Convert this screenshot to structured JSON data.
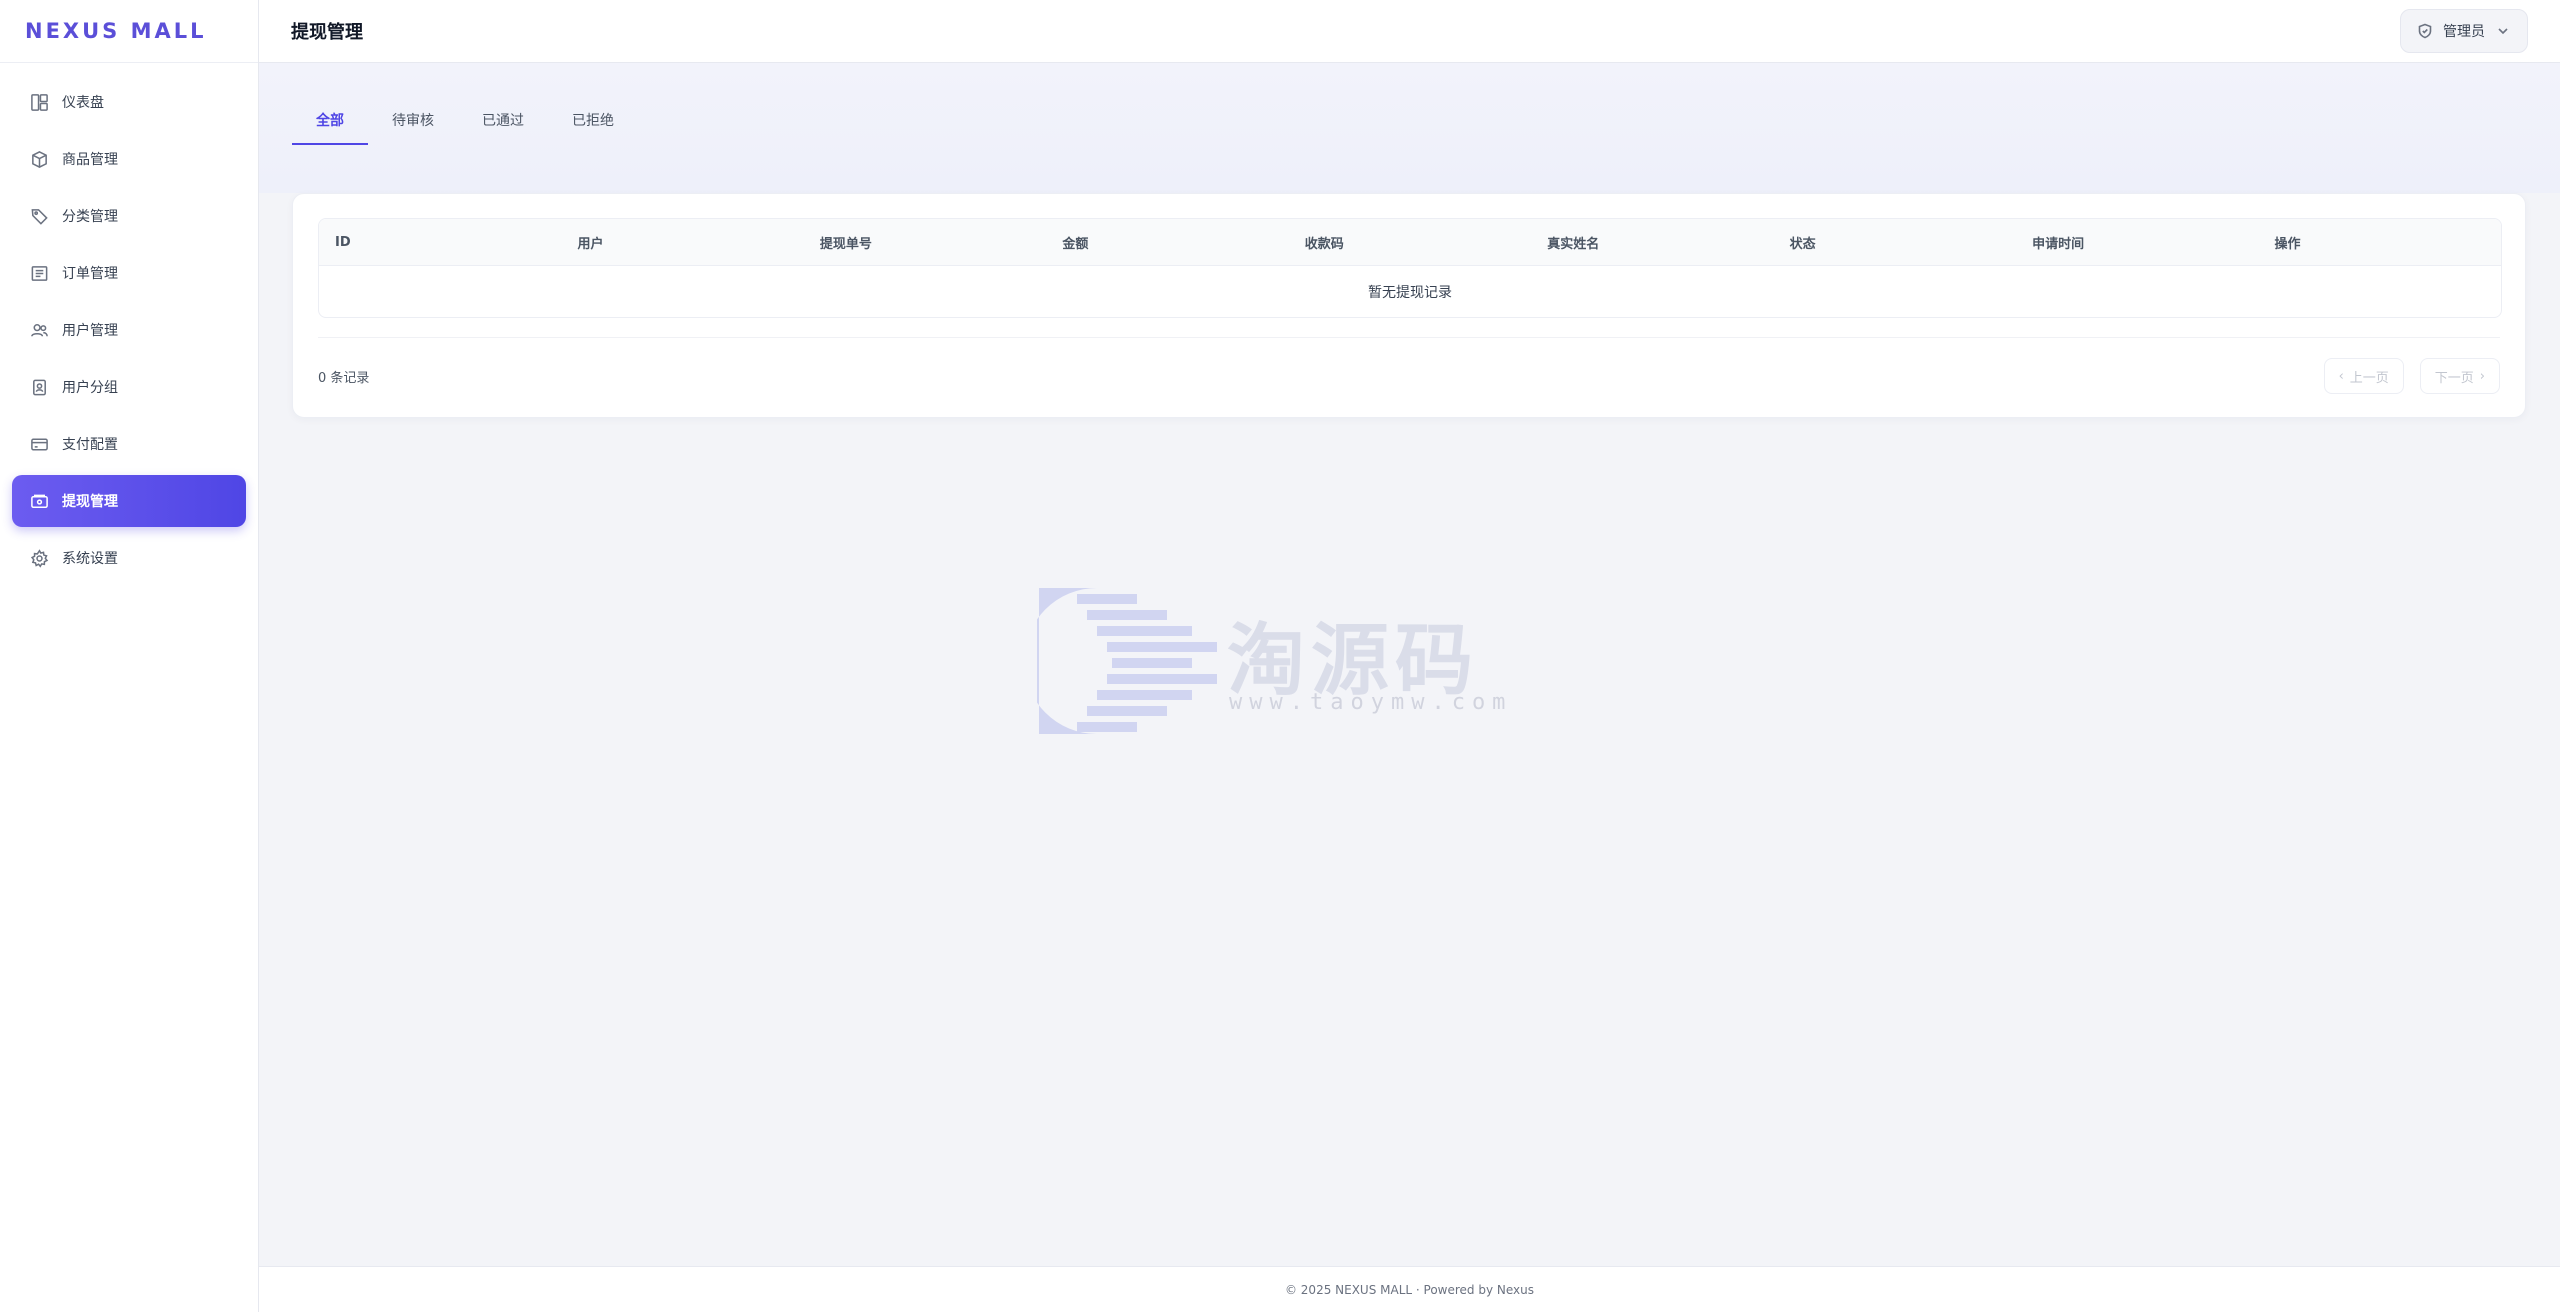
{
  "brand": "NEXUS MALL",
  "sidebar": {
    "items": [
      {
        "label": "仪表盘",
        "icon": "dashboard-icon"
      },
      {
        "label": "商品管理",
        "icon": "box-icon"
      },
      {
        "label": "分类管理",
        "icon": "tag-icon"
      },
      {
        "label": "订单管理",
        "icon": "list-icon"
      },
      {
        "label": "用户管理",
        "icon": "users-icon"
      },
      {
        "label": "用户分组",
        "icon": "user-badge-icon"
      },
      {
        "label": "支付配置",
        "icon": "card-icon"
      },
      {
        "label": "提现管理",
        "icon": "wallet-icon",
        "active": true
      },
      {
        "label": "系统设置",
        "icon": "gear-icon"
      }
    ]
  },
  "header": {
    "title": "提现管理",
    "user": "管理员"
  },
  "tabs": [
    {
      "label": "全部",
      "active": true
    },
    {
      "label": "待审核"
    },
    {
      "label": "已通过"
    },
    {
      "label": "已拒绝"
    }
  ],
  "table": {
    "columns": [
      "ID",
      "用户",
      "提现单号",
      "金额",
      "收款码",
      "真实姓名",
      "状态",
      "申请时间",
      "操作"
    ],
    "empty_text": "暂无提现记录",
    "count_text": "0 条记录",
    "prev_label": "上一页",
    "next_label": "下一页"
  },
  "watermark": {
    "text": "淘源码",
    "url": "www.taoymw.com"
  },
  "footer": "© 2025 NEXUS MALL · Powered by Nexus",
  "colors": {
    "accent": "#4f46e5",
    "brand": "#5b4fd8",
    "background": "#f3f4f8"
  }
}
